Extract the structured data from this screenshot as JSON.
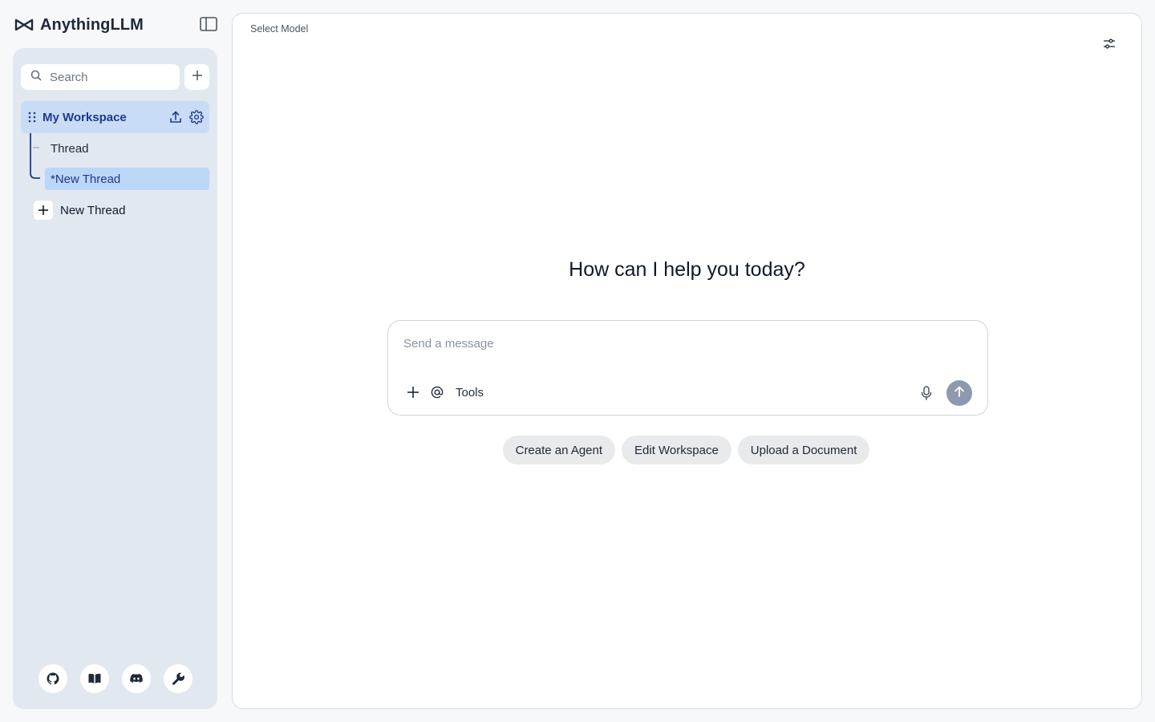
{
  "app": {
    "name": "AnythingLLM",
    "accent": "#1e3a8a",
    "icons": {
      "logo": "anythingllm-logo-icon",
      "sidebar_toggle": "sidebar-toggle-icon"
    }
  },
  "sidebar": {
    "search": {
      "placeholder": "Search"
    },
    "workspace": {
      "name": "My Workspace",
      "selected": true
    },
    "threads": [
      {
        "label": "Thread",
        "active": false
      },
      {
        "label": "*New Thread",
        "active": true
      }
    ],
    "new_thread_label": "New Thread",
    "footer_icons": [
      "github-icon",
      "book-icon",
      "discord-icon",
      "wrench-icon"
    ]
  },
  "main": {
    "select_model_label": "Select Model",
    "greeting": "How can I help you today?",
    "composer": {
      "placeholder": "Send a message",
      "tools_label": "Tools"
    },
    "quick_actions": [
      "Create an Agent",
      "Edit Workspace",
      "Upload a Document"
    ]
  }
}
